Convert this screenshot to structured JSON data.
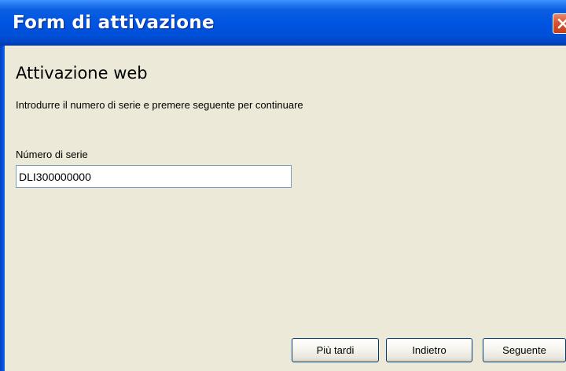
{
  "window": {
    "title": "Form di attivazione"
  },
  "icons": {
    "close": "close-icon"
  },
  "content": {
    "heading": "Attivazione web",
    "instructions": "Introdurre il numero di serie e premere seguente per continuare",
    "serial_label": "Número di serie",
    "serial_value": "DLI300000000"
  },
  "buttons": {
    "later": "Più tardi",
    "back": "Indietro",
    "next": "Seguente"
  },
  "colors": {
    "titlebar": "#0054e3",
    "close_button": "#d9532c",
    "dialog_background": "#ece9d8",
    "button_border": "#003c74",
    "input_border": "#7f9db9"
  }
}
